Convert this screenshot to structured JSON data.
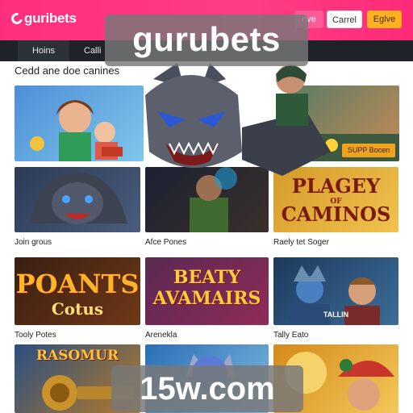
{
  "header": {
    "logo_text": "guribets",
    "btn_left": "rlve",
    "btn_middle": "Carrel",
    "btn_right": "Eglve"
  },
  "nav": {
    "items": [
      "Hoins",
      "Calli"
    ]
  },
  "section_title": "Cedd ane doe canines",
  "overlay": {
    "brand": "gurubets",
    "domain": "15w.com"
  },
  "cards": {
    "row1_promo": "SUPP Bocen",
    "row2": {
      "c_title_top": "PLAGEY",
      "c_title_mid": "OF",
      "c_title_bottom": "CAMINOS"
    },
    "row2_labels": [
      "Join grous",
      "Afce Pones",
      "Raely tet Soger"
    ],
    "row3": {
      "a_title_top": "POANTS",
      "a_title_bottom": "Cotus",
      "b_title_top": "BEATY",
      "b_title_bottom": "AVAMAIRS",
      "c_small": "TALLIN"
    },
    "row3_labels": [
      "Tooly Potes",
      "Arenekla",
      "Tally Eato"
    ],
    "row4": {
      "a_title": "RASOMUR"
    }
  },
  "colors": {
    "header_bg": "#ff3d86",
    "nav_bg": "#1f2329",
    "accent_yellow": "#ffb21e"
  }
}
